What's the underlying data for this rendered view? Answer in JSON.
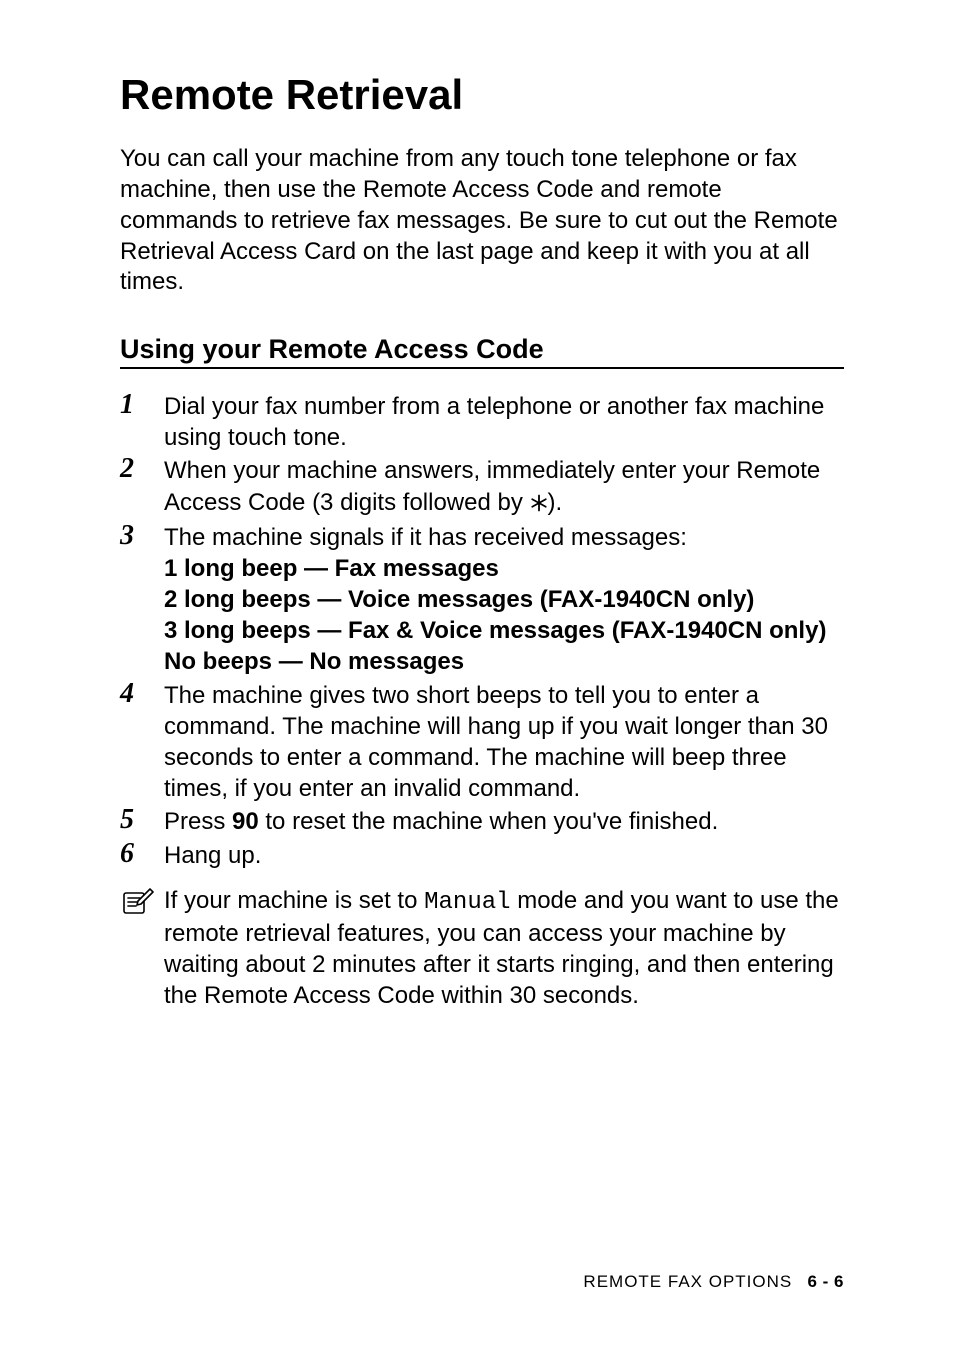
{
  "title": "Remote Retrieval",
  "intro": "You can call your machine from any touch tone telephone or fax machine, then use the Remote Access Code and remote commands to retrieve fax messages. Be sure to cut out the Remote Retrieval Access Card on the last page and keep it with you at all times.",
  "subheading": "Using your Remote Access Code",
  "steps": {
    "n1": "1",
    "s1": "Dial your fax number from a telephone or another fax machine using touch tone.",
    "n2": "2",
    "s2a": "When your machine answers, immediately enter your Remote Access Code (3 digits followed by ",
    "s2b": ").",
    "n3": "3",
    "s3_intro": "The machine signals if it has received messages:",
    "s3_l1": "1 long beep — Fax messages",
    "s3_l2": "2 long beeps — Voice messages (FAX-1940CN only)",
    "s3_l3": "3 long beeps — Fax & Voice messages (FAX-1940CN only)",
    "s3_l4": "No beeps — No messages",
    "n4": "4",
    "s4": "The machine gives two short beeps to tell you to enter a command. The machine will hang up if you wait longer than 30 seconds to enter a command. The machine will beep three times, if you enter an invalid command.",
    "n5": "5",
    "s5a": "Press ",
    "s5b": "90",
    "s5c": " to reset the machine when you've finished.",
    "n6": "6",
    "s6": "Hang up."
  },
  "note": {
    "a": "If your machine is set to ",
    "mode": "Manual",
    "b": " mode and you want to use the remote retrieval features, you can access your machine by waiting about 2 minutes after it starts ringing, and then entering the Remote Access Code within 30 seconds."
  },
  "footer": {
    "section": "REMOTE FAX OPTIONS",
    "page": "6 - 6"
  }
}
